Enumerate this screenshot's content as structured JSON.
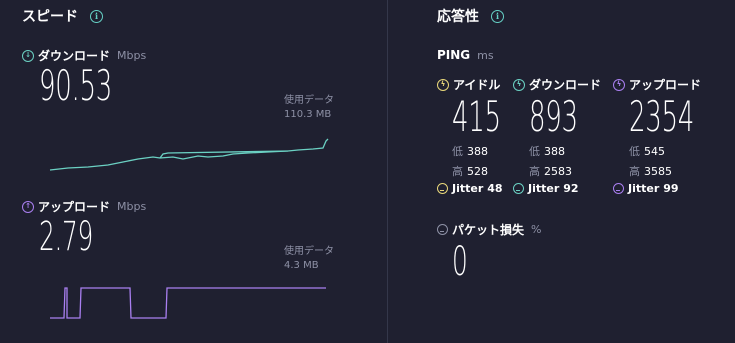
{
  "speed": {
    "title": "スピード",
    "download": {
      "label": "ダウンロード",
      "unit": "Mbps",
      "value": "90.53",
      "data_used_label": "使用データ",
      "data_used": "110.3 MB",
      "color": "#6bd1c3"
    },
    "upload": {
      "label": "アップロード",
      "unit": "Mbps",
      "value": "2.79",
      "data_used_label": "使用データ",
      "data_used": "4.3 MB",
      "color": "#a97ff0"
    }
  },
  "responsiveness": {
    "title": "応答性",
    "ping_label": "PING",
    "ping_unit": "ms",
    "idle": {
      "label": "アイドル",
      "value": "415",
      "low_label": "低",
      "low": "388",
      "high_label": "高",
      "high": "528",
      "jitter_label": "Jitter",
      "jitter": "48",
      "color": "#e8d77a"
    },
    "download": {
      "label": "ダウンロード",
      "value": "893",
      "low_label": "低",
      "low": "388",
      "high_label": "高",
      "high": "2583",
      "jitter_label": "Jitter",
      "jitter": "92",
      "color": "#6bd1c3"
    },
    "upload": {
      "label": "アップロード",
      "value": "2354",
      "low_label": "低",
      "low": "545",
      "high_label": "高",
      "high": "3585",
      "jitter_label": "Jitter",
      "jitter": "99",
      "color": "#a97ff0"
    },
    "packet_loss": {
      "label": "パケット損失",
      "unit": "%",
      "value": "0"
    }
  },
  "colors": {
    "background": "#1f2030",
    "accent_info": "#66d1c6",
    "muted_text": "#8e91a6"
  }
}
